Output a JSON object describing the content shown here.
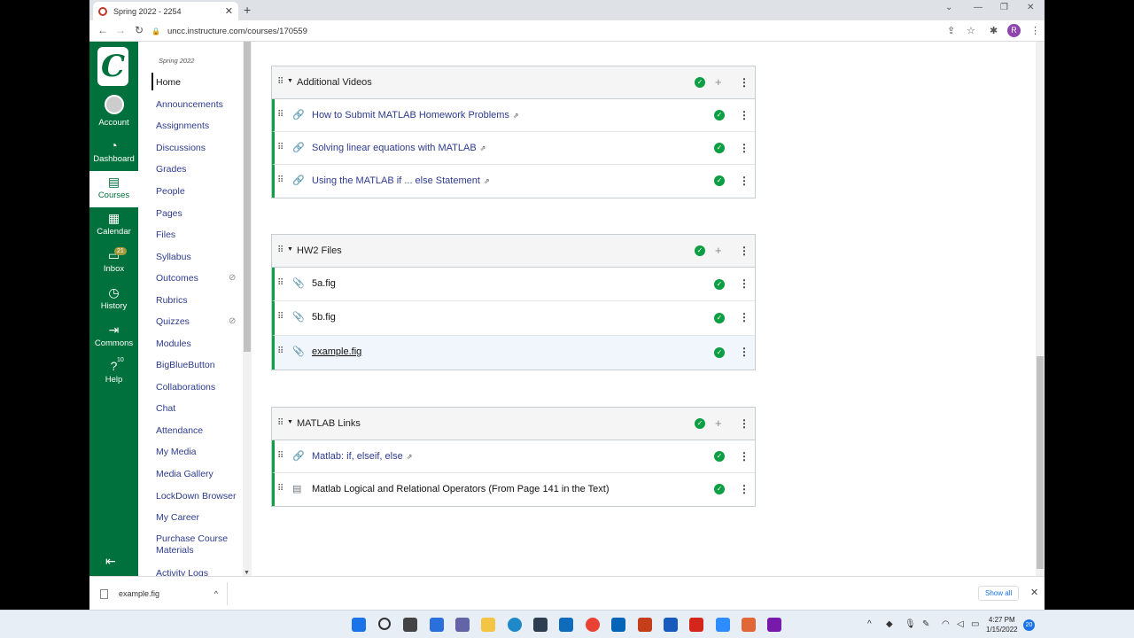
{
  "browser": {
    "tab_title": "Spring 2022 - 2254",
    "url": "uncc.instructure.com/courses/170559"
  },
  "global_nav": {
    "items": [
      {
        "label": "Account",
        "icon": "avatar-icon"
      },
      {
        "label": "Dashboard",
        "icon": "dashboard-icon"
      },
      {
        "label": "Courses",
        "icon": "courses-icon"
      },
      {
        "label": "Calendar",
        "icon": "calendar-icon"
      },
      {
        "label": "Inbox",
        "icon": "inbox-icon",
        "badge": "21"
      },
      {
        "label": "History",
        "icon": "clock-icon"
      },
      {
        "label": "Commons",
        "icon": "commons-icon"
      },
      {
        "label": "Help",
        "icon": "help-icon",
        "badge": "10"
      }
    ]
  },
  "course_nav": {
    "term": "Spring 2022",
    "items": [
      "Home",
      "Announcements",
      "Assignments",
      "Discussions",
      "Grades",
      "People",
      "Pages",
      "Files",
      "Syllabus",
      "Outcomes",
      "Rubrics",
      "Quizzes",
      "Modules",
      "BigBlueButton",
      "Collaborations",
      "Chat",
      "Attendance",
      "My Media",
      "Media Gallery",
      "LockDown Browser",
      "My Career",
      "Purchase Course Materials",
      "Activity Logs"
    ]
  },
  "modules": [
    {
      "title": "Additional Videos",
      "items": [
        {
          "label": "How to Submit MATLAB Homework Problems",
          "type": "link-icon",
          "external": true
        },
        {
          "label": "Solving linear equations with MATLAB",
          "type": "link-icon",
          "external": true
        },
        {
          "label": "Using the MATLAB if ... else Statement",
          "type": "link-icon",
          "external": true
        }
      ]
    },
    {
      "title": "HW2 Files",
      "items": [
        {
          "label": "5a.fig",
          "type": "attachment-icon",
          "external": false
        },
        {
          "label": "5b.fig",
          "type": "attachment-icon",
          "external": false
        },
        {
          "label": "example.fig",
          "type": "attachment-icon",
          "external": false
        }
      ]
    },
    {
      "title": "MATLAB Links",
      "items": [
        {
          "label": "Matlab: if, elseif, else",
          "type": "link-icon",
          "external": true
        },
        {
          "label": "Matlab Logical and Relational Operators (From Page 141 in the Text)",
          "type": "page-icon",
          "external": false
        }
      ]
    }
  ],
  "download_bar": {
    "filename": "example.fig",
    "show_all": "Show all"
  },
  "taskbar": {
    "time": "4:27 PM",
    "date": "1/15/2022",
    "notifications": "20"
  },
  "colors": {
    "brand_green": "#00703c",
    "publish_green": "#0b9e43",
    "link_blue": "#2d3b8d"
  }
}
